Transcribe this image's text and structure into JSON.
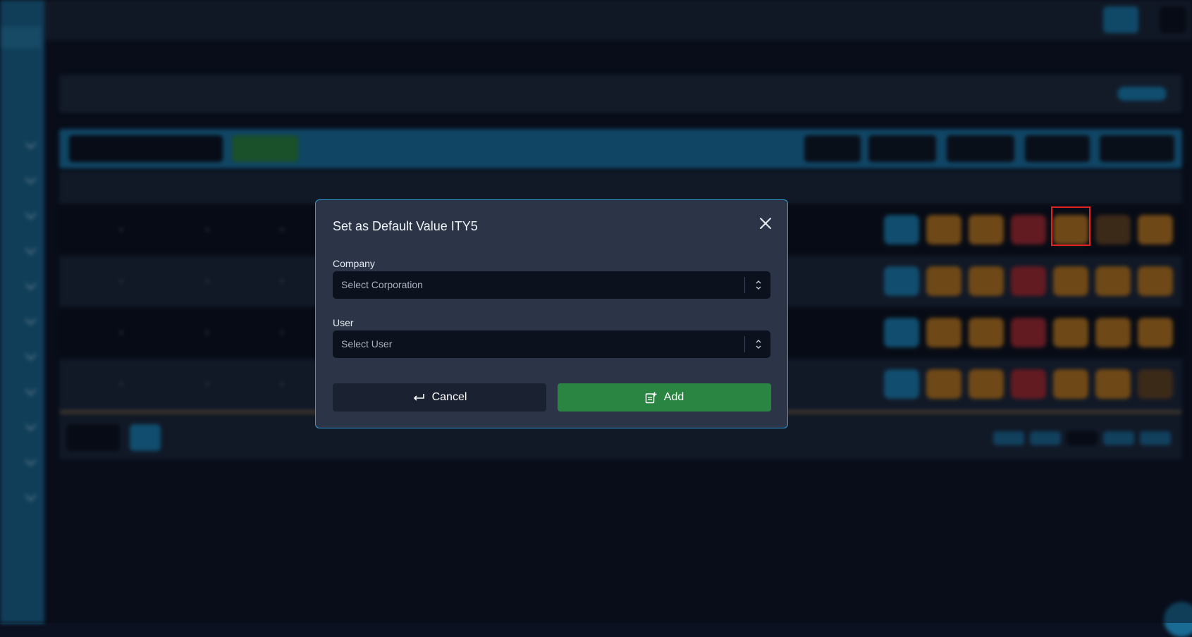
{
  "modal": {
    "title": "Set as Default Value ITY5",
    "company_label": "Company",
    "company_placeholder": "Select Corporation",
    "user_label": "User",
    "user_placeholder": "Select User",
    "cancel_label": "Cancel",
    "add_label": "Add"
  },
  "colors": {
    "modal_border": "#2f9ad3",
    "add_button": "#2a8542",
    "highlight": "#e02424"
  },
  "icons": [
    "close-icon",
    "return-arrow-icon",
    "add-document-icon",
    "select-caret-icon"
  ]
}
